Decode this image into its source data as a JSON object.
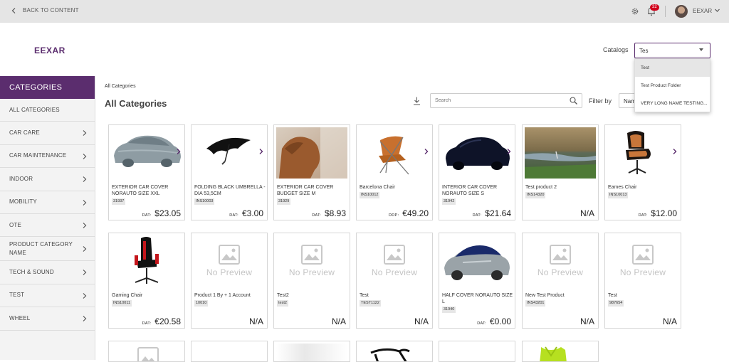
{
  "topbar": {
    "back_label": "BACK TO CONTENT",
    "notification_count": "32",
    "user_name": "EEXAR"
  },
  "brand": "EEXAR",
  "catalogs": {
    "label": "Catalogs",
    "value": "Tes",
    "options": [
      "Test",
      "Test Product Folder",
      "VERY LONG NAME TESTING..."
    ]
  },
  "sidebar": {
    "header": "CATEGORIES",
    "items": [
      {
        "label": "ALL CATEGORIES",
        "has_chevron": false
      },
      {
        "label": "CAR CARE",
        "has_chevron": true
      },
      {
        "label": "CAR MAINTENANCE",
        "has_chevron": true
      },
      {
        "label": "INDOOR",
        "has_chevron": true
      },
      {
        "label": "MOBILITY",
        "has_chevron": true
      },
      {
        "label": "OTE",
        "has_chevron": true
      },
      {
        "label": "PRODUCT CATEGORY NAME",
        "has_chevron": true
      },
      {
        "label": "TECH & SOUND",
        "has_chevron": true
      },
      {
        "label": "TEST",
        "has_chevron": true
      },
      {
        "label": "WHEEL",
        "has_chevron": true
      }
    ]
  },
  "main": {
    "breadcrumb": "All Categories",
    "title": "All Categories",
    "search_placeholder": "Search",
    "filter_label": "Filter by",
    "filter_value": "Nam"
  },
  "products": [
    {
      "name": "EXTERIOR CAR COVER NORAUTO SIZE XXL",
      "code": "31937",
      "price_label": "DAT:",
      "price": "$23.05",
      "image": "car-cover-grey"
    },
    {
      "name": "FOLDING BLACK UMBRELLA - DIA 53,5CM",
      "code": "INS10003",
      "price_label": "DAT:",
      "price": "€3.00",
      "image": "umbrella"
    },
    {
      "name": "EXTERIOR CAR COVER BUDGET SIZE M",
      "code": "31929",
      "price_label": "DAT:",
      "price": "$8.93",
      "image": "dog-in-car"
    },
    {
      "name": "Barcelona Chair",
      "code": "INS10012",
      "price_label": "DDP:",
      "price": "€49.20",
      "image": "barcelona-chair"
    },
    {
      "name": "INTERIOR CAR COVER NORAUTO SIZE S",
      "code": "31942",
      "price_label": "DAT:",
      "price": "$21.64",
      "image": "car-cover-navy"
    },
    {
      "name": "Test product 2",
      "code": "INS14320",
      "price_label": "",
      "price": "N/A",
      "image": "wetland-bird"
    },
    {
      "name": "Eames Chair",
      "code": "INS10013",
      "price_label": "DAT:",
      "price": "$12.00",
      "image": "eames-chair"
    },
    {
      "name": "Gaming Chair",
      "code": "INS10011",
      "price_label": "DAT:",
      "price": "€20.58",
      "image": "gaming-chair"
    },
    {
      "name": "Product 1 By + 1 Account",
      "code": "10010",
      "price_label": "",
      "price": "N/A",
      "image": "no-preview"
    },
    {
      "name": "Test2",
      "code": "test2",
      "price_label": "",
      "price": "N/A",
      "image": "no-preview"
    },
    {
      "name": "Test",
      "code": "TEST1122",
      "price_label": "",
      "price": "N/A",
      "image": "no-preview"
    },
    {
      "name": "HALF COVER NORAUTO SIZE L",
      "code": "31940",
      "price_label": "DAT:",
      "price": "€0.00",
      "image": "half-cover-car"
    },
    {
      "name": "New Test Product",
      "code": "INS43201",
      "price_label": "",
      "price": "N/A",
      "image": "no-preview"
    },
    {
      "name": "Test",
      "code": "987654",
      "price_label": "",
      "price": "N/A",
      "image": "no-preview"
    }
  ],
  "no_preview_text": "No Preview",
  "partial_row": [
    "no-preview",
    "blank",
    "blank",
    "glasses",
    "blank",
    "safety-vest"
  ],
  "colors": {
    "brand": "#5b2d6e",
    "topbar": "#e5e5e5",
    "badge": "#d0021b"
  }
}
